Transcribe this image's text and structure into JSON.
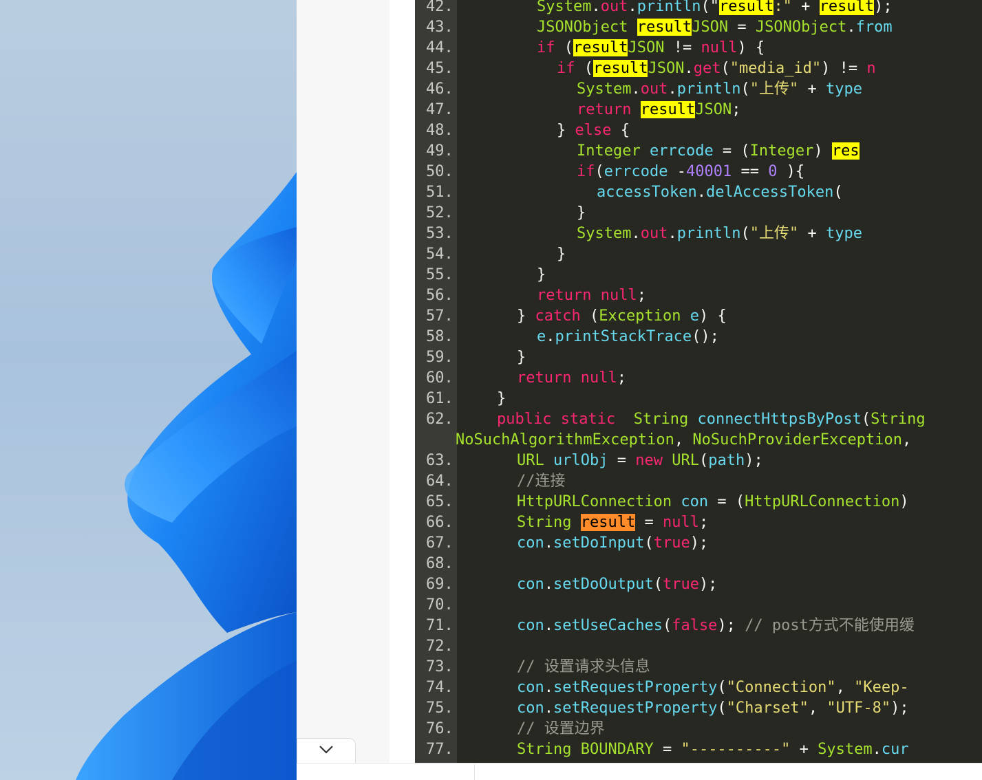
{
  "desktop": {
    "wallpaper": "Windows 11 bloom",
    "colors": {
      "background": "#b9cde0",
      "bloom_light": "#4aa8ff",
      "bloom_dark": "#0d5fd6"
    }
  },
  "page": {
    "collapse_icon": "chevron-down-icon"
  },
  "code": {
    "theme_colors": {
      "background": "#272822",
      "keyword": "#f92672",
      "type": "#a6e22e",
      "function": "#66d9ef",
      "string": "#e6db74",
      "number": "#ae81ff",
      "comment": "#9a9a90",
      "search_highlight": "#ffff00",
      "current_highlight": "#ff8c28"
    },
    "lines": [
      {
        "n": "42.",
        "indent": 6,
        "tokens": [
          [
            "ty",
            "System"
          ],
          [
            "pl",
            "."
          ],
          [
            "kw",
            "out"
          ],
          [
            "pl",
            "."
          ],
          [
            "fn",
            "println"
          ],
          [
            "pl",
            "(\""
          ],
          [
            "hl",
            "result"
          ],
          [
            "st",
            ":\""
          ],
          [
            "pl",
            " + "
          ],
          [
            "hl",
            "result"
          ],
          [
            "pl",
            ");"
          ]
        ]
      },
      {
        "n": "43.",
        "indent": 6,
        "tokens": [
          [
            "ty",
            "JSONObject"
          ],
          [
            "pl",
            " "
          ],
          [
            "hl",
            "result"
          ],
          [
            "ty",
            "JSON"
          ],
          [
            "pl",
            " = "
          ],
          [
            "ty",
            "JSONObject"
          ],
          [
            "pl",
            "."
          ],
          [
            "fn",
            "from"
          ]
        ]
      },
      {
        "n": "44.",
        "indent": 6,
        "tokens": [
          [
            "kw",
            "if"
          ],
          [
            "pl",
            " ("
          ],
          [
            "hl",
            "result"
          ],
          [
            "ty",
            "JSON"
          ],
          [
            "pl",
            " != "
          ],
          [
            "kw",
            "null"
          ],
          [
            "pl",
            ") {"
          ]
        ]
      },
      {
        "n": "45.",
        "indent": 8,
        "tokens": [
          [
            "kw",
            "if"
          ],
          [
            "pl",
            " ("
          ],
          [
            "hl",
            "result"
          ],
          [
            "ty",
            "JSON"
          ],
          [
            "pl",
            "."
          ],
          [
            "kw",
            "get"
          ],
          [
            "pl",
            "("
          ],
          [
            "st",
            "\"media_id\""
          ],
          [
            "pl",
            ") != "
          ],
          [
            "kw",
            "n"
          ]
        ]
      },
      {
        "n": "46.",
        "indent": 10,
        "tokens": [
          [
            "ty",
            "System"
          ],
          [
            "pl",
            "."
          ],
          [
            "kw",
            "out"
          ],
          [
            "pl",
            "."
          ],
          [
            "fn",
            "println"
          ],
          [
            "pl",
            "("
          ],
          [
            "st",
            "\"上传\""
          ],
          [
            "pl",
            " + "
          ],
          [
            "fn",
            "type"
          ]
        ]
      },
      {
        "n": "47.",
        "indent": 10,
        "tokens": [
          [
            "kw",
            "return"
          ],
          [
            "pl",
            " "
          ],
          [
            "hl",
            "result"
          ],
          [
            "ty",
            "JSON"
          ],
          [
            "pl",
            ";"
          ]
        ]
      },
      {
        "n": "48.",
        "indent": 8,
        "tokens": [
          [
            "pl",
            "} "
          ],
          [
            "kw",
            "else"
          ],
          [
            "pl",
            " {"
          ]
        ]
      },
      {
        "n": "49.",
        "indent": 10,
        "tokens": [
          [
            "ty",
            "Integer"
          ],
          [
            "pl",
            " "
          ],
          [
            "fn",
            "errcode"
          ],
          [
            "pl",
            " = ("
          ],
          [
            "ty",
            "Integer"
          ],
          [
            "pl",
            ") "
          ],
          [
            "hl",
            "res"
          ]
        ]
      },
      {
        "n": "50.",
        "indent": 10,
        "tokens": [
          [
            "kw",
            "if"
          ],
          [
            "pl",
            "("
          ],
          [
            "fn",
            "errcode"
          ],
          [
            "pl",
            " -"
          ],
          [
            "nu",
            "40001"
          ],
          [
            "pl",
            " == "
          ],
          [
            "nu",
            "0"
          ],
          [
            "pl",
            " ){"
          ]
        ]
      },
      {
        "n": "51.",
        "indent": 12,
        "tokens": [
          [
            "fn",
            "accessToken"
          ],
          [
            "pl",
            "."
          ],
          [
            "fn",
            "delAccessToken"
          ],
          [
            "pl",
            "("
          ]
        ]
      },
      {
        "n": "52.",
        "indent": 10,
        "tokens": [
          [
            "pl",
            "}"
          ]
        ]
      },
      {
        "n": "53.",
        "indent": 10,
        "tokens": [
          [
            "ty",
            "System"
          ],
          [
            "pl",
            "."
          ],
          [
            "kw",
            "out"
          ],
          [
            "pl",
            "."
          ],
          [
            "fn",
            "println"
          ],
          [
            "pl",
            "("
          ],
          [
            "st",
            "\"上传\""
          ],
          [
            "pl",
            " + "
          ],
          [
            "fn",
            "type"
          ]
        ]
      },
      {
        "n": "54.",
        "indent": 8,
        "tokens": [
          [
            "pl",
            "}"
          ]
        ]
      },
      {
        "n": "55.",
        "indent": 6,
        "tokens": [
          [
            "pl",
            "}"
          ]
        ]
      },
      {
        "n": "56.",
        "indent": 6,
        "tokens": [
          [
            "kw",
            "return"
          ],
          [
            "pl",
            " "
          ],
          [
            "kw",
            "null"
          ],
          [
            "pl",
            ";"
          ]
        ]
      },
      {
        "n": "57.",
        "indent": 4,
        "tokens": [
          [
            "pl",
            "} "
          ],
          [
            "kw",
            "catch"
          ],
          [
            "pl",
            " ("
          ],
          [
            "ty",
            "Exception"
          ],
          [
            "pl",
            " "
          ],
          [
            "fn",
            "e"
          ],
          [
            "pl",
            ") {"
          ]
        ]
      },
      {
        "n": "58.",
        "indent": 6,
        "tokens": [
          [
            "fn",
            "e"
          ],
          [
            "pl",
            "."
          ],
          [
            "fn",
            "printStackTrace"
          ],
          [
            "pl",
            "();"
          ]
        ]
      },
      {
        "n": "59.",
        "indent": 4,
        "tokens": [
          [
            "pl",
            "}"
          ]
        ]
      },
      {
        "n": "60.",
        "indent": 4,
        "tokens": [
          [
            "kw",
            "return"
          ],
          [
            "pl",
            " "
          ],
          [
            "kw",
            "null"
          ],
          [
            "pl",
            ";"
          ]
        ]
      },
      {
        "n": "61.",
        "indent": 2,
        "tokens": [
          [
            "pl",
            "}"
          ]
        ]
      },
      {
        "n": "62.",
        "indent": 2,
        "tokens": [
          [
            "kw",
            "public"
          ],
          [
            "pl",
            " "
          ],
          [
            "kw",
            "static"
          ],
          [
            "pl",
            "  "
          ],
          [
            "ty",
            "String"
          ],
          [
            "pl",
            " "
          ],
          [
            "fn",
            "connectHttpsByPost"
          ],
          [
            "pl",
            "("
          ],
          [
            "ty",
            "String"
          ]
        ]
      },
      {
        "n": "",
        "indent": 0,
        "tokens": [
          [
            "ty",
            "NoSuchAlgorithmException"
          ],
          [
            "pl",
            ", "
          ],
          [
            "ty",
            "NoSuchProviderException"
          ],
          [
            "pl",
            ","
          ]
        ]
      },
      {
        "n": "63.",
        "indent": 4,
        "tokens": [
          [
            "ty",
            "URL"
          ],
          [
            "pl",
            " "
          ],
          [
            "fn",
            "urlObj"
          ],
          [
            "pl",
            " = "
          ],
          [
            "kw",
            "new"
          ],
          [
            "pl",
            " "
          ],
          [
            "ty",
            "URL"
          ],
          [
            "pl",
            "("
          ],
          [
            "fn",
            "path"
          ],
          [
            "pl",
            ");"
          ]
        ]
      },
      {
        "n": "64.",
        "indent": 4,
        "tokens": [
          [
            "cm",
            "//连接"
          ]
        ]
      },
      {
        "n": "65.",
        "indent": 4,
        "tokens": [
          [
            "ty",
            "HttpURLConnection"
          ],
          [
            "pl",
            " "
          ],
          [
            "fn",
            "con"
          ],
          [
            "pl",
            " = ("
          ],
          [
            "ty",
            "HttpURLConnection"
          ],
          [
            "pl",
            ")"
          ]
        ]
      },
      {
        "n": "66.",
        "indent": 4,
        "tokens": [
          [
            "ty",
            "String"
          ],
          [
            "pl",
            " "
          ],
          [
            "hl2",
            "result"
          ],
          [
            "pl",
            " = "
          ],
          [
            "kw",
            "null"
          ],
          [
            "pl",
            ";"
          ]
        ]
      },
      {
        "n": "67.",
        "indent": 4,
        "tokens": [
          [
            "fn",
            "con"
          ],
          [
            "pl",
            "."
          ],
          [
            "fn",
            "setDoInput"
          ],
          [
            "pl",
            "("
          ],
          [
            "kw",
            "true"
          ],
          [
            "pl",
            ");"
          ]
        ]
      },
      {
        "n": "68.",
        "indent": 0,
        "tokens": []
      },
      {
        "n": "69.",
        "indent": 4,
        "tokens": [
          [
            "fn",
            "con"
          ],
          [
            "pl",
            "."
          ],
          [
            "fn",
            "setDoOutput"
          ],
          [
            "pl",
            "("
          ],
          [
            "kw",
            "true"
          ],
          [
            "pl",
            ");"
          ]
        ]
      },
      {
        "n": "70.",
        "indent": 0,
        "tokens": []
      },
      {
        "n": "71.",
        "indent": 4,
        "tokens": [
          [
            "fn",
            "con"
          ],
          [
            "pl",
            "."
          ],
          [
            "fn",
            "setUseCaches"
          ],
          [
            "pl",
            "("
          ],
          [
            "kw",
            "false"
          ],
          [
            "pl",
            "); "
          ],
          [
            "cm",
            "// post方式不能使用缓"
          ]
        ]
      },
      {
        "n": "72.",
        "indent": 0,
        "tokens": []
      },
      {
        "n": "73.",
        "indent": 4,
        "tokens": [
          [
            "cm",
            "// 设置请求头信息"
          ]
        ]
      },
      {
        "n": "74.",
        "indent": 4,
        "tokens": [
          [
            "fn",
            "con"
          ],
          [
            "pl",
            "."
          ],
          [
            "fn",
            "setRequestProperty"
          ],
          [
            "pl",
            "("
          ],
          [
            "st",
            "\"Connection\""
          ],
          [
            "pl",
            ", "
          ],
          [
            "st",
            "\"Keep-"
          ]
        ]
      },
      {
        "n": "75.",
        "indent": 4,
        "tokens": [
          [
            "fn",
            "con"
          ],
          [
            "pl",
            "."
          ],
          [
            "fn",
            "setRequestProperty"
          ],
          [
            "pl",
            "("
          ],
          [
            "st",
            "\"Charset\""
          ],
          [
            "pl",
            ", "
          ],
          [
            "st",
            "\"UTF-8\""
          ],
          [
            "pl",
            ");"
          ]
        ]
      },
      {
        "n": "76.",
        "indent": 4,
        "tokens": [
          [
            "cm",
            "// 设置边界"
          ]
        ]
      },
      {
        "n": "77.",
        "indent": 4,
        "tokens": [
          [
            "ty",
            "String"
          ],
          [
            "pl",
            " "
          ],
          [
            "ty",
            "BOUNDARY"
          ],
          [
            "pl",
            " = "
          ],
          [
            "st",
            "\"----------\""
          ],
          [
            "pl",
            " + "
          ],
          [
            "ty",
            "System"
          ],
          [
            "pl",
            "."
          ],
          [
            "fn",
            "cur"
          ]
        ]
      }
    ]
  }
}
